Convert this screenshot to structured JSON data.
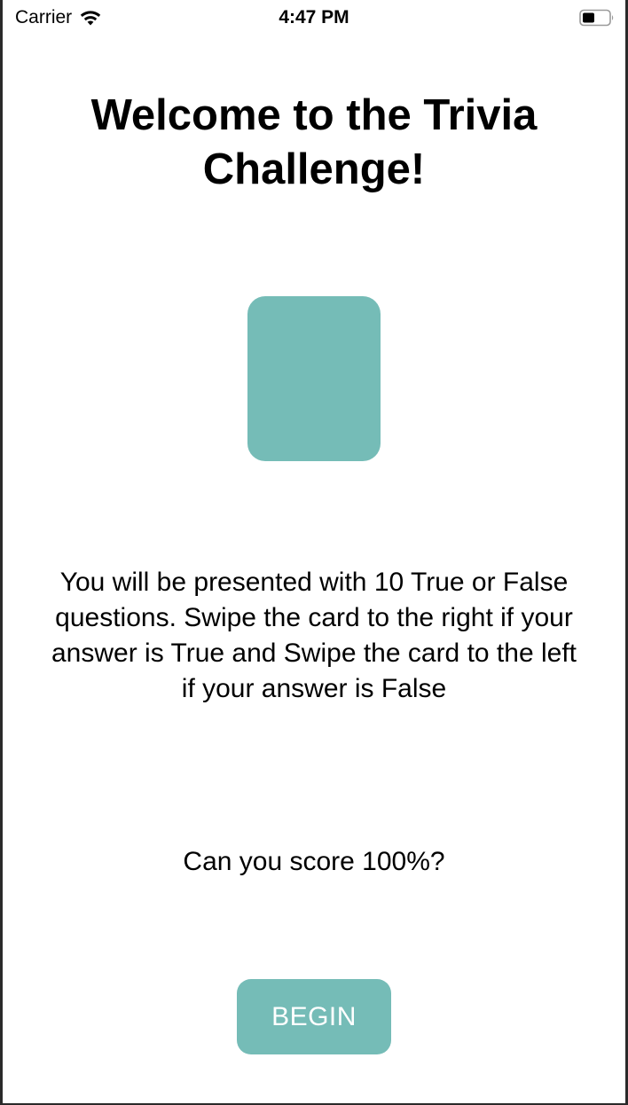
{
  "status_bar": {
    "carrier": "Carrier",
    "time": "4:47 PM",
    "wifi_icon": "wifi-icon",
    "battery_icon": "battery-icon"
  },
  "welcome": {
    "title": "Welcome to the Trivia Challenge!",
    "instructions": "You will be presented with 10 True or False questions. Swipe the card to the right if your answer is True and Swipe the card to the left if your answer is False",
    "question": "Can you score 100%?",
    "begin_label": "BEGIN"
  },
  "colors": {
    "accent": "#75bcb7",
    "background": "#ffffff",
    "text": "#000000"
  }
}
